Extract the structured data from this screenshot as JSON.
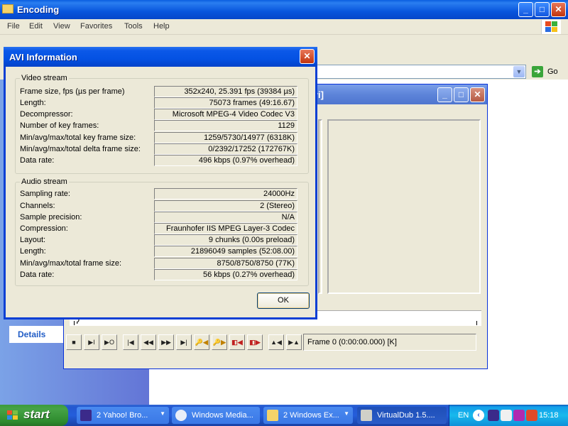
{
  "explorer": {
    "title": "Encoding",
    "menu": [
      "File",
      "Edit",
      "View",
      "Favorites",
      "Tools",
      "Help"
    ],
    "address_go_label": "Go",
    "details_tab_label": "Details"
  },
  "virtualdub": {
    "title": "-2).avi]",
    "frame_status": "Frame 0 (0:00:00.000) [K]"
  },
  "dialog": {
    "title": "AVI Information",
    "ok_label": "OK",
    "video": {
      "title": "Video stream",
      "rows": [
        {
          "label": "Frame size, fps (µs per frame)",
          "value": "352x240, 25.391 fps (39384 µs)"
        },
        {
          "label": "Length:",
          "value": "75073 frames (49:16.67)"
        },
        {
          "label": "Decompressor:",
          "value": "Microsoft MPEG-4 Video Codec V3"
        },
        {
          "label": "Number of key frames:",
          "value": "1129"
        },
        {
          "label": "Min/avg/max/total key frame size:",
          "value": "1259/5730/14977 (6318K)"
        },
        {
          "label": "Min/avg/max/total delta frame size:",
          "value": "0/2392/17252 (172767K)"
        },
        {
          "label": "Data rate:",
          "value": "496 kbps (0.97% overhead)"
        }
      ]
    },
    "audio": {
      "title": "Audio stream",
      "rows": [
        {
          "label": "Sampling rate:",
          "value": "24000Hz"
        },
        {
          "label": "Channels:",
          "value": "2 (Stereo)"
        },
        {
          "label": "Sample precision:",
          "value": "N/A"
        },
        {
          "label": "Compression:",
          "value": "Fraunhofer IIS MPEG Layer-3 Codec"
        },
        {
          "label": "Layout:",
          "value": "9 chunks (0.00s preload)"
        },
        {
          "label": "Length:",
          "value": "21896049 samples (52:08.00)"
        },
        {
          "label": "Min/avg/max/total frame size:",
          "value": "8750/8750/8750 (77K)"
        },
        {
          "label": "Data rate:",
          "value": "56 kbps (0.27% overhead)"
        }
      ]
    }
  },
  "taskbar": {
    "start_label": "start",
    "tasks": [
      {
        "label": "2 Yahoo! Bro...",
        "icon": "yahoo-messenger-icon"
      },
      {
        "label": "Windows Media...",
        "icon": "windows-media-icon"
      },
      {
        "label": "2 Windows Ex...",
        "icon": "folder-icon"
      },
      {
        "label": "VirtualDub 1.5....",
        "icon": "virtualdub-icon"
      }
    ],
    "language": "EN",
    "clock": "15:18"
  }
}
